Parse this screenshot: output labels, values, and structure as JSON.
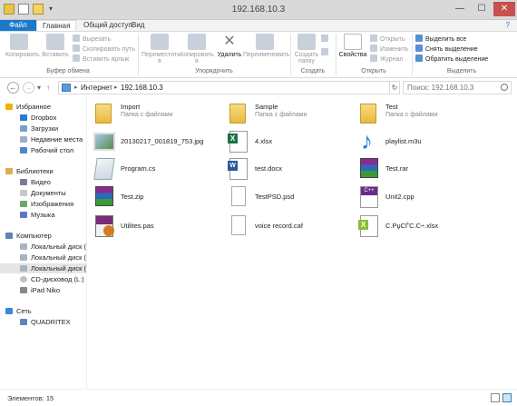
{
  "window": {
    "title": "192.168.10.3",
    "quick_access_dropdown": "▾",
    "minimize": "—",
    "maximize": "☐",
    "close": "✕"
  },
  "ribbon_tabs": {
    "file": "Файл",
    "home": "Главная",
    "share": "Общий доступ",
    "view": "Вид",
    "help": "?"
  },
  "ribbon": {
    "clipboard": {
      "label": "Буфер обмена",
      "copy": "Копировать",
      "paste": "Вставить",
      "cut": "Вырезать",
      "copy_path": "Скопировать путь",
      "paste_shortcut": "Вставить ярлык"
    },
    "organize": {
      "label": "Упорядочить",
      "move_to": "Переместить в",
      "copy_to": "Копировать в",
      "delete": "Удалить",
      "rename": "Переименовать"
    },
    "create": {
      "label": "Создать",
      "new_folder": "Создать папку"
    },
    "open": {
      "label": "Открыть",
      "properties": "Свойства",
      "open": "Открыть",
      "edit": "Изменить",
      "history": "Журнал"
    },
    "select": {
      "label": "Выделить",
      "select_all": "Выделить все",
      "select_none": "Снять выделение",
      "invert": "Обратить выделение"
    }
  },
  "address": {
    "back": "←",
    "forward": "→",
    "recent": "▾",
    "up": "↑",
    "crumbs": [
      "Интернет",
      "192.168.10.3"
    ],
    "separator": "▸",
    "refresh": "↻",
    "search_placeholder": "Поиск: 192.168.10.3"
  },
  "sidebar": {
    "favorites": {
      "label": "Избранное",
      "items": [
        "Dropbox",
        "Загрузки",
        "Недавние места",
        "Рабочий стол"
      ]
    },
    "libraries": {
      "label": "Библиотеки",
      "items": [
        "Видео",
        "Документы",
        "Изображения",
        "Музыка"
      ]
    },
    "computer": {
      "label": "Компьютер",
      "items": [
        "Локальный диск (C:)",
        "Локальный диск (D:)",
        "Локальный диск (E:)",
        "CD-дисковод (L:)",
        "iPad Niko"
      ]
    },
    "network": {
      "label": "Сеть",
      "items": [
        "QUADRITEX"
      ]
    }
  },
  "files": [
    {
      "name": "Import",
      "sub": "Папка с файлами",
      "icon": "folder-icon"
    },
    {
      "name": "Sample",
      "sub": "Папка с файлами",
      "icon": "folder-icon"
    },
    {
      "name": "Test",
      "sub": "Папка с файлами",
      "icon": "folder-icon"
    },
    {
      "name": "20130217_001819_753.jpg",
      "icon": "image-file-icon"
    },
    {
      "name": "4.xlsx",
      "icon": "excel-file-icon"
    },
    {
      "name": "playlist.m3u",
      "icon": "music-file-icon"
    },
    {
      "name": "Program.cs",
      "icon": "cs-file-icon"
    },
    {
      "name": "test.docx",
      "icon": "word-file-icon"
    },
    {
      "name": "Test.rar",
      "icon": "rar-file-icon"
    },
    {
      "name": "Test.zip",
      "icon": "zip-file-icon"
    },
    {
      "name": "TestPSD.psd",
      "icon": "psd-file-icon"
    },
    {
      "name": "Unit2.cpp",
      "icon": "cpp-file-icon"
    },
    {
      "name": "Utilites.pas",
      "icon": "pas-file-icon"
    },
    {
      "name": "voice record.caf",
      "icon": "generic-file-icon"
    },
    {
      "name": "С.РџСЃС.С÷.xlsx",
      "icon": "csv-file-icon"
    }
  ],
  "status": {
    "count": "Элементов: 15"
  }
}
